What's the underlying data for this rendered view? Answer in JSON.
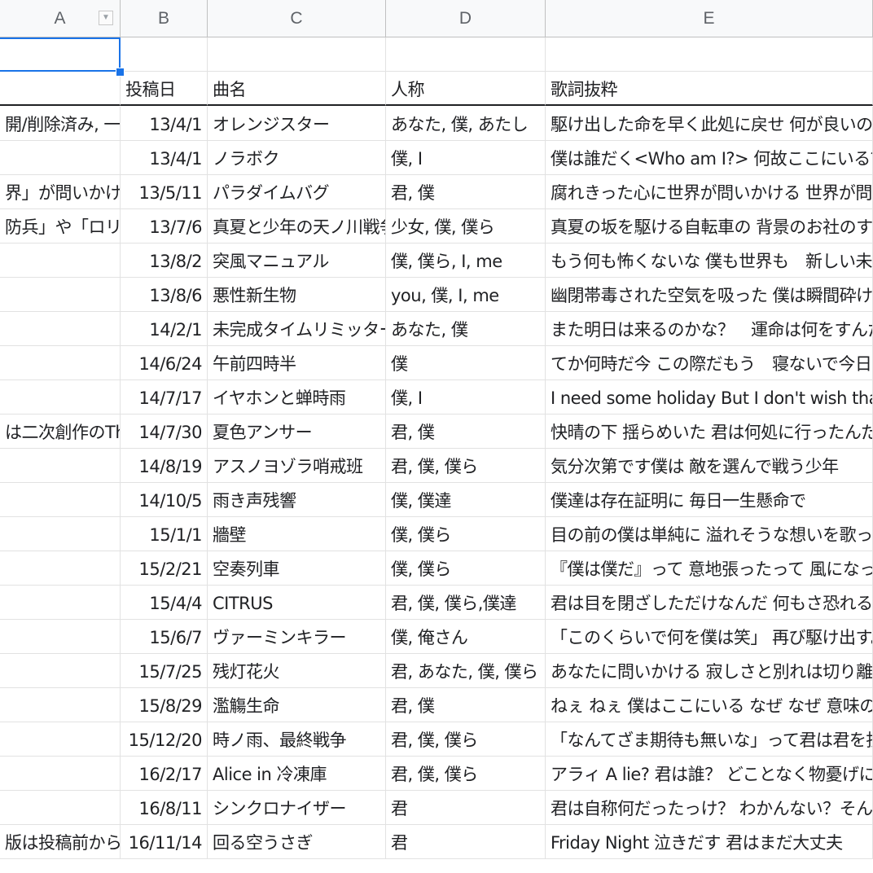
{
  "columns": [
    "A",
    "B",
    "C",
    "D",
    "E"
  ],
  "header": {
    "a": "",
    "b": "投稿日",
    "c": "曲名",
    "d": "人称",
    "e": "歌詞抜粋"
  },
  "rows": [
    {
      "a": "開/削除済み, 一人称",
      "b": "13/4/1",
      "c": "オレンジスター",
      "d": "あなた, 僕, あたし",
      "e": "駆け出した命を早く此処に戻せ 何が良いの？ あ"
    },
    {
      "a": "",
      "b": "13/4/1",
      "c": "ノラボク",
      "d": "僕, I",
      "e": "僕は誰だく<Who am I?> 何故ここにいる？ Na z"
    },
    {
      "a": "界」が問いかけて",
      "b": "13/5/11",
      "c": "パラダイムバグ",
      "d": "君, 僕",
      "e": "腐れきった心に世界が問いかける 世界が問いか"
    },
    {
      "a": "防兵」や「ロリコ",
      "b": "13/7/6",
      "c": "真夏と少年の天ノ川戦争",
      "d": "少女, 僕, 僕ら",
      "e": "真夏の坂を駆ける自転車の 背景のお社のすぐそ"
    },
    {
      "a": "",
      "b": "13/8/2",
      "c": "突風マニュアル",
      "d": "僕, 僕ら, I, me",
      "e": "もう何も怖くないな 僕も世界も　新しい未来さ"
    },
    {
      "a": "",
      "b": "13/8/6",
      "c": "悪性新生物",
      "d": "you, 僕, I, me",
      "e": "幽閉帯毒された空気を吸った 僕は瞬間砕けて光"
    },
    {
      "a": "",
      "b": "14/2/1",
      "c": "未完成タイムリミッター",
      "d": "あなた, 僕",
      "e": "また明日は来るのかな？　運命は何をすんだ？"
    },
    {
      "a": "",
      "b": "14/6/24",
      "c": "午前四時半",
      "d": "僕",
      "e": "てか何時だ今 この際だもう　寝ないで今日 乗り"
    },
    {
      "a": "",
      "b": "14/7/17",
      "c": "イヤホンと蝉時雨",
      "d": "僕, I",
      "e": "I need some holiday But I don't wish that everyd"
    },
    {
      "a": "は二次創作のThe",
      "b": "14/7/30",
      "c": "夏色アンサー",
      "d": "君, 僕",
      "e": "快晴の下 揺らめいた 君は何処に行ったんだっけ"
    },
    {
      "a": "",
      "b": "14/8/19",
      "c": "アスノヨゾラ哨戒班",
      "d": "君, 僕, 僕ら",
      "e": "気分次第です僕は 敵を選んで戦う少年"
    },
    {
      "a": "",
      "b": "14/10/5",
      "c": "雨き声残響",
      "d": "僕, 僕達",
      "e": "僕達は存在証明に 毎日一生懸命で"
    },
    {
      "a": "",
      "b": "15/1/1",
      "c": "牆壁",
      "d": "僕, 僕ら",
      "e": "目の前の僕は単純に 溢れそうな想いを歌ってい"
    },
    {
      "a": "",
      "b": "15/2/21",
      "c": "空奏列車",
      "d": "僕, 僕ら",
      "e": "『僕は僕だ』って 意地張ったって 風になってし"
    },
    {
      "a": "",
      "b": "15/4/4",
      "c": "CITRUS",
      "d": "君, 僕, 僕ら,僕達",
      "e": "君は目を閉ざしただけなんだ 何もさ恐れること"
    },
    {
      "a": "",
      "b": "15/6/7",
      "c": "ヴァーミンキラー",
      "d": "僕, 俺さん",
      "e": "「このくらいで何を僕は笑」 再び駆け出す。(w"
    },
    {
      "a": "",
      "b": "15/7/25",
      "c": "残灯花火",
      "d": "君, あなた, 僕, 僕ら",
      "e": "あなたに問いかける 寂しさと別れは切り離され"
    },
    {
      "a": "",
      "b": "15/8/29",
      "c": "濫觴生命",
      "d": "君, 僕",
      "e": "ねぇ ねぇ 僕はここにいる なぜ なぜ 意味の無い"
    },
    {
      "a": "",
      "b": "15/12/20",
      "c": "時ノ雨、最終戦争",
      "d": "君, 僕, 僕ら",
      "e": "「なんてざま期待も無いな」って君は君を掻き"
    },
    {
      "a": "",
      "b": "16/2/17",
      "c": "Alice in 冷凍庫",
      "d": "君, 僕, 僕ら",
      "e": "アラィ A lie? 君は誰？ どことなく物憂げに 裸足"
    },
    {
      "a": "",
      "b": "16/8/11",
      "c": "シンクロナイザー",
      "d": "君",
      "e": "君は自称何だったっけ？ わかんない？そんなは"
    },
    {
      "a": "版は投稿前からSo",
      "b": "16/11/14",
      "c": "回る空うさぎ",
      "d": "君",
      "e": "Friday Night 泣きだす 君はまだ大丈夫"
    }
  ]
}
